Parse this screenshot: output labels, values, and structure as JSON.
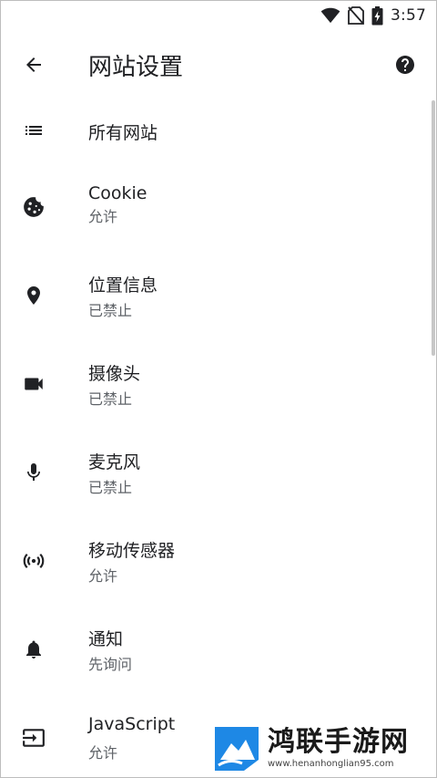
{
  "status_bar": {
    "time": "3:57",
    "icons": [
      "wifi-icon",
      "no-sim-icon",
      "battery-charging-icon"
    ]
  },
  "app_bar": {
    "title": "网站设置",
    "back_icon": "arrow-back-icon",
    "help_icon": "help-icon"
  },
  "items": [
    {
      "id": "all-sites",
      "icon": "list-icon",
      "title": "所有网站",
      "subtitle": ""
    },
    {
      "id": "cookie",
      "icon": "cookie-icon",
      "title": "Cookie",
      "subtitle": "允许"
    },
    {
      "id": "location",
      "icon": "location-pin-icon",
      "title": "位置信息",
      "subtitle": "已禁止"
    },
    {
      "id": "camera",
      "icon": "videocam-icon",
      "title": "摄像头",
      "subtitle": "已禁止"
    },
    {
      "id": "microphone",
      "icon": "mic-icon",
      "title": "麦克风",
      "subtitle": "已禁止"
    },
    {
      "id": "motion-sensors",
      "icon": "sensors-icon",
      "title": "移动传感器",
      "subtitle": "允许"
    },
    {
      "id": "notifications",
      "icon": "bell-icon",
      "title": "通知",
      "subtitle": "先询问"
    },
    {
      "id": "javascript",
      "icon": "input-icon",
      "title": "JavaScript",
      "subtitle": "允许"
    }
  ],
  "watermark": {
    "brand": "鸿联手游网",
    "url": "www.henanhonglian95.com"
  },
  "colors": {
    "text_primary": "#202124",
    "text_secondary": "#5f6368",
    "icon": "#202124",
    "watermark_blue": "#1e88e5"
  }
}
